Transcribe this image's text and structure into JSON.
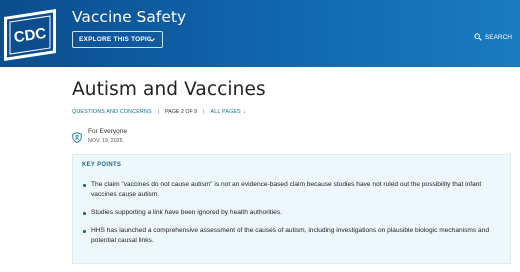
{
  "header": {
    "logo_text": "CDC",
    "site_title": "Vaccine Safety",
    "explore_label": "EXPLORE THIS TOPIC",
    "search_label": "SEARCH"
  },
  "page": {
    "title": "Autism and Vaccines",
    "nav": {
      "section_link": "QUESTIONS AND CONCERNS",
      "page_counter": "PAGE 2 OF 9",
      "all_pages_link": "ALL PAGES",
      "all_pages_arrow": "↓"
    },
    "audience": "For Everyone",
    "date": "NOV. 19, 2025"
  },
  "key_points": {
    "title": "KEY POINTS",
    "items": [
      "The claim \"vaccines do not cause autism\" is not an evidence-based claim because studies have not ruled out the possibility that infant vaccines cause autism.",
      "Studies supporting a link have been ignored by health authorities.",
      "HHS has launched a comprehensive assessment of the causes of autism, including investigations on plausible biologic mechanisms and potential causal links."
    ]
  },
  "colors": {
    "header_start": "#0b4d8e",
    "header_end": "#1a7bc0",
    "link": "#0a6e8a",
    "keypoints_bg": "#eef7fb"
  },
  "icons": {
    "logo": "cdc-logo",
    "explore": "chevron-down-icon",
    "search": "search-icon",
    "audience": "shield-person-icon"
  }
}
